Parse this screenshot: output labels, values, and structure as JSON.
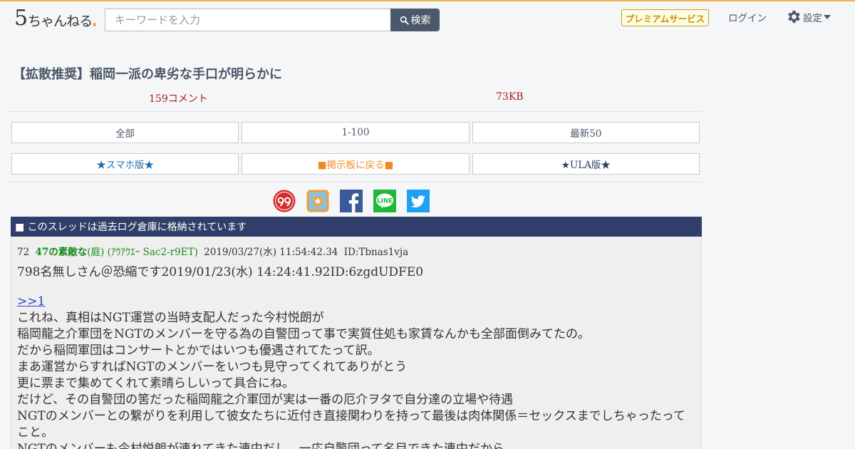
{
  "header": {
    "logo_text": "5ちゃんねる",
    "search": {
      "placeholder": "キーワードを入力",
      "button_label": "検索"
    },
    "premium_label": "プレミアムサービス",
    "login_label": "ログイン",
    "settings_label": "設定",
    "accent_color": "#f0b24a"
  },
  "thread": {
    "title": "【拡散推奨】稲岡一派の卑劣な手口が明らかに",
    "comment_count": "159コメント",
    "size": "73KB"
  },
  "nav_row1": [
    "全部",
    "1-100",
    "最新50"
  ],
  "nav_row2": [
    "★スマホ版★",
    "■掲示板に戻る■",
    "★ULA版★"
  ],
  "share_icons": [
    "99-icon",
    "bookmark-icon",
    "facebook-icon",
    "line-icon",
    "twitter-icon"
  ],
  "archive_notice": "■ このスレッドは過去ログ倉庫に格納されています",
  "post": {
    "number": "72",
    "name_bold": "47の素敵な",
    "name_rest": "(庭) (ｱｳｱｳｴｰ Sac2-r9ET)",
    "date": "2019/03/27(水) 11:54:42.34",
    "id": "ID:Tbnas1vja",
    "quote_header": "798名無しさん＠恐縮です2019/01/23(水) 14:24:41.92ID:6zgdUDFE0",
    "anchor": ">>1",
    "lines": [
      "これね、真相はNGT運営の当時支配人だった今村悦朗が",
      "稲岡龍之介軍団をNGTのメンバーを守る為の自警団って事で実質住処も家賃なんかも全部面倒みてたの。",
      "だから稲岡軍団はコンサートとかではいつも優遇されてたって訳。",
      "まあ運営からすればNGTのメンバーをいつも見守ってくれてありがとう",
      "更に票まで集めてくれて素晴らしいって具合にね。",
      "だけど、その自警団の筈だった稲岡龍之介軍団が実は一番の厄介ヲタで自分達の立場や待遇",
      "NGTのメンバーとの繋がりを利用して彼女たちに近付き直接関わりを持って最後は肉体関係＝セックスまでしちゃったってこと。",
      "NGTのメンバーも今村悦朗が連れてきた連中だし、一応自警団って名目できた連中だから"
    ]
  }
}
